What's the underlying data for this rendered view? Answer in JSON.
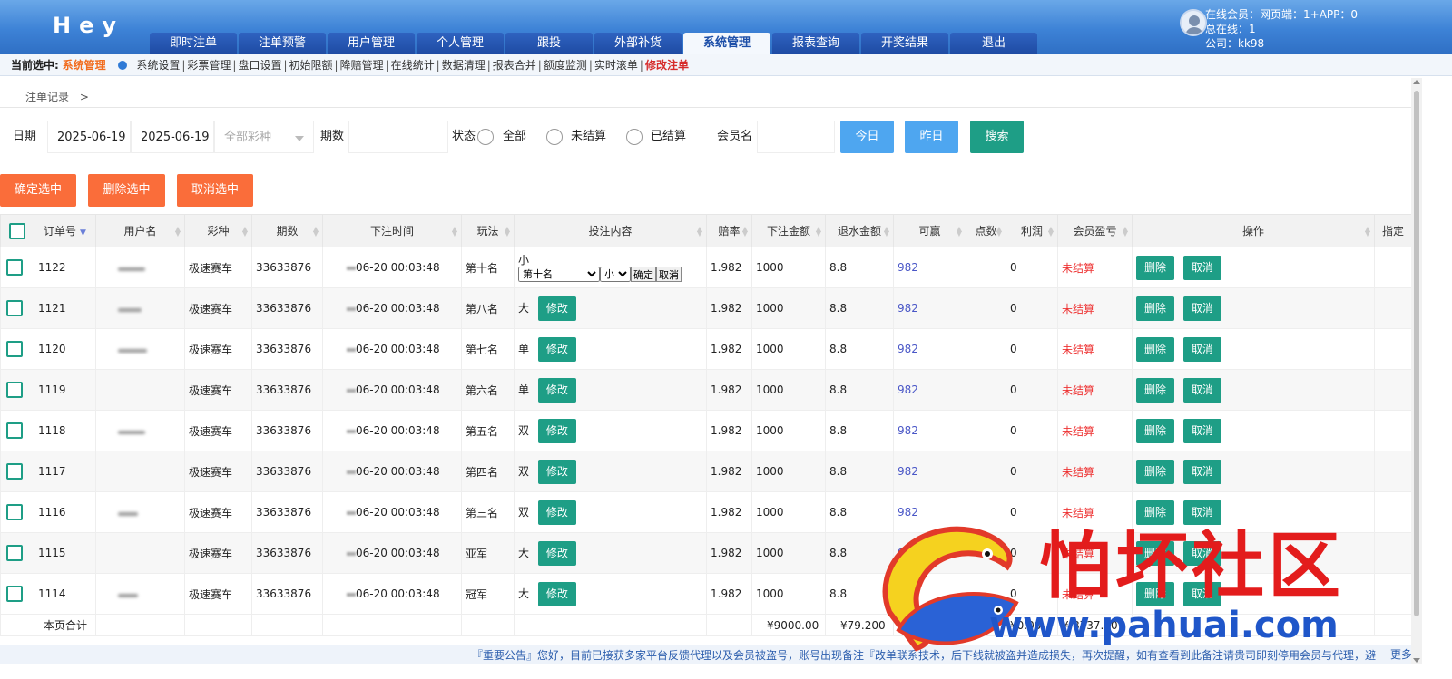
{
  "header": {
    "logo": "Hey",
    "nav": [
      "即时注单",
      "注单预警",
      "用户管理",
      "个人管理",
      "跟投",
      "外部补货",
      "系统管理",
      "报表查询",
      "开奖结果",
      "退出"
    ],
    "active_nav": "系统管理",
    "user": {
      "online": "在线会员：网页端：1+APP：0",
      "total": "总在线：1",
      "company": "公司：kk98"
    }
  },
  "subnav": {
    "current_label": "当前选中:",
    "current_value": "系统管理",
    "items": [
      "系统设置",
      "彩票管理",
      "盘口设置",
      "初始限额",
      "降赔管理",
      "在线统计",
      "数据清理",
      "报表合并",
      "额度监测",
      "实时滚单"
    ],
    "highlight": "修改注单"
  },
  "breadcrumb": {
    "label": "注单记录",
    "arrow": ">"
  },
  "filters": {
    "date_label": "日期",
    "date_from": "2025-06-19",
    "date_to": "2025-06-19",
    "lottery_placeholder": "全部彩种",
    "period_label": "期数",
    "status_label": "状态",
    "status_options": [
      "全部",
      "未结算",
      "已结算"
    ],
    "member_label": "会员名",
    "today_btn": "今日",
    "yesterday_btn": "昨日",
    "search_btn": "搜索"
  },
  "actions": {
    "confirm": "确定选中",
    "delete": "删除选中",
    "cancel": "取消选中"
  },
  "table": {
    "headers": [
      "订单号",
      "用户名",
      "彩种",
      "期数",
      "下注时间",
      "玩法",
      "投注内容",
      "赔率",
      "下注金额",
      "退水金额",
      "可赢",
      "点数",
      "利润",
      "会员盈亏",
      "操作",
      "指定"
    ],
    "row_delete": "删除",
    "row_cancel": "取消",
    "edit_label": "修改",
    "rows": [
      {
        "id": "1122",
        "lottery": "极速赛车",
        "period": "33633876",
        "time": "06-20 00:03:48",
        "play": "第十名",
        "content": "小",
        "odds": "1.982",
        "amount": "1000",
        "rebate": "8.8",
        "win": "982",
        "points": "",
        "profit": "0",
        "pnl": "未结算",
        "editing": true
      },
      {
        "id": "1121",
        "lottery": "极速赛车",
        "period": "33633876",
        "time": "06-20 00:03:48",
        "play": "第八名",
        "content": "大",
        "odds": "1.982",
        "amount": "1000",
        "rebate": "8.8",
        "win": "982",
        "points": "",
        "profit": "0",
        "pnl": "未结算"
      },
      {
        "id": "1120",
        "lottery": "极速赛车",
        "period": "33633876",
        "time": "06-20 00:03:48",
        "play": "第七名",
        "content": "单",
        "odds": "1.982",
        "amount": "1000",
        "rebate": "8.8",
        "win": "982",
        "points": "",
        "profit": "0",
        "pnl": "未结算"
      },
      {
        "id": "1119",
        "lottery": "极速赛车",
        "period": "33633876",
        "time": "06-20 00:03:48",
        "play": "第六名",
        "content": "单",
        "odds": "1.982",
        "amount": "1000",
        "rebate": "8.8",
        "win": "982",
        "points": "",
        "profit": "0",
        "pnl": "未结算"
      },
      {
        "id": "1118",
        "lottery": "极速赛车",
        "period": "33633876",
        "time": "06-20 00:03:48",
        "play": "第五名",
        "content": "双",
        "odds": "1.982",
        "amount": "1000",
        "rebate": "8.8",
        "win": "982",
        "points": "",
        "profit": "0",
        "pnl": "未结算"
      },
      {
        "id": "1117",
        "lottery": "极速赛车",
        "period": "33633876",
        "time": "06-20 00:03:48",
        "play": "第四名",
        "content": "双",
        "odds": "1.982",
        "amount": "1000",
        "rebate": "8.8",
        "win": "982",
        "points": "",
        "profit": "0",
        "pnl": "未结算"
      },
      {
        "id": "1116",
        "lottery": "极速赛车",
        "period": "33633876",
        "time": "06-20 00:03:48",
        "play": "第三名",
        "content": "双",
        "odds": "1.982",
        "amount": "1000",
        "rebate": "8.8",
        "win": "982",
        "points": "",
        "profit": "0",
        "pnl": "未结算"
      },
      {
        "id": "1115",
        "lottery": "极速赛车",
        "period": "33633876",
        "time": "06-20 00:03:48",
        "play": "亚军",
        "content": "大",
        "odds": "1.982",
        "amount": "1000",
        "rebate": "8.8",
        "win": "982",
        "points": "",
        "profit": "0",
        "pnl": "未结算"
      },
      {
        "id": "1114",
        "lottery": "极速赛车",
        "period": "33633876",
        "time": "06-20 00:03:48",
        "play": "冠军",
        "content": "大",
        "odds": "1.982",
        "amount": "1000",
        "rebate": "8.8",
        "win": "982",
        "points": "",
        "profit": "0",
        "pnl": "未结算"
      }
    ],
    "edit_row": {
      "select_play": "第十名",
      "select_content": "小",
      "confirm": "确定",
      "cancel": "取消"
    },
    "footer": {
      "label": "本页合计",
      "amount": "¥9000.00",
      "rebate": "¥79.200",
      "win": "¥8838.00",
      "profit": "¥0.00",
      "pnl": "¥-8737.20"
    }
  },
  "notice": {
    "text": "『重要公告』您好，目前已接获多家平台反馈代理以及会员被盗号，账号出现备注『改单联系技术，后下线就被盗并造成损失，再次提醒，如有查看到此备注请贵司即刻停用会员与代理，避",
    "more": "更多"
  },
  "watermark": {
    "text": "怕坏社区",
    "url": "www.pahuai.com"
  },
  "colors": {
    "header": "#3d82d6",
    "teal": "#1e9e86",
    "orange": "#fa6d3a",
    "blue_btn": "#4ea6f0",
    "pending": "#e33333",
    "win": "#4a57c7"
  }
}
